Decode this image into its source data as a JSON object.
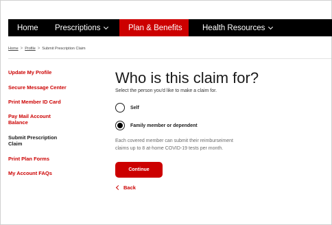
{
  "nav": {
    "items": [
      {
        "label": "Home"
      },
      {
        "label": "Prescriptions"
      },
      {
        "label": "Plan & Benefits"
      },
      {
        "label": "Health Resources"
      }
    ]
  },
  "breadcrumb": {
    "items": [
      "Home",
      "Profile",
      "Submit Prescription Claim"
    ],
    "separator": ">"
  },
  "sidebar": {
    "items": [
      {
        "label": "Update My Profile"
      },
      {
        "label": "Secure Message Center"
      },
      {
        "label": "Print Member ID Card"
      },
      {
        "label": "Pay Mail Account",
        "label2": "Balance"
      },
      {
        "label": "Submit Prescription",
        "label2": "Claim"
      },
      {
        "label": "Print Plan Forms"
      },
      {
        "label": "My Account FAQs"
      }
    ]
  },
  "main": {
    "title": "Who is this claim for?",
    "subtitle": "Select the person you'd like to make a claim for.",
    "options": [
      {
        "label": "Self",
        "checked": false
      },
      {
        "label": "Family member or dependent",
        "checked": true
      }
    ],
    "note_line1": "Each covered member can submit their reimburseiment",
    "note_line2": "claims up to 8 at-home COVID-19 tests per month.",
    "continue_label": "Continue",
    "back_label": "Back"
  },
  "colors": {
    "accent": "#cc0000",
    "nav_bg": "#000000",
    "text": "#1a1a1a"
  }
}
